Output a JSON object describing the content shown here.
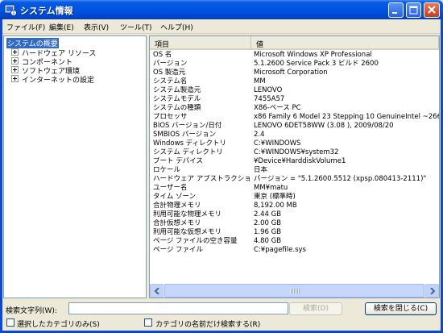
{
  "window": {
    "title": "システム情報",
    "icon": "system-info-icon",
    "accent": "#0054e3"
  },
  "menu": [
    "ファイル(F)",
    "編集(E)",
    "表示(V)",
    "ツール(T)",
    "ヘルプ(H)"
  ],
  "tree": {
    "root": "システムの概要",
    "children": [
      "ハードウェア リソース",
      "コンポーネント",
      "ソフトウェア環境",
      "インターネットの設定"
    ]
  },
  "table": {
    "headers": [
      "項目",
      "値"
    ],
    "rows": [
      [
        "OS 名",
        "Microsoft Windows XP Professional"
      ],
      [
        "バージョン",
        "5.1.2600 Service Pack 3 ビルド 2600"
      ],
      [
        "OS 製造元",
        "Microsoft Corporation"
      ],
      [
        "システム名",
        "MM"
      ],
      [
        "システム製造元",
        "LENOVO"
      ],
      [
        "システムモデル",
        "7455A57"
      ],
      [
        "システムの種類",
        "X86-ベース PC"
      ],
      [
        "プロセッサ",
        "x86 Family 6 Model 23 Stepping 10 GenuineIntel ~2660"
      ],
      [
        "BIOS バージョン/日付",
        "LENOVO 6DET58WW (3.08 ), 2009/08/20"
      ],
      [
        "SMBIOS バージョン",
        "2.4"
      ],
      [
        "Windows ディレクトリ",
        "C:¥WINDOWS"
      ],
      [
        "システム ディレクトリ",
        "C:¥WINDOWS¥system32"
      ],
      [
        "ブート デバイス",
        "¥Device¥HarddiskVolume1"
      ],
      [
        "ロケール",
        "日本"
      ],
      [
        "ハードウェア アブストラクション...",
        "バージョン = \"5.1.2600.5512 (xpsp.080413-2111)\""
      ],
      [
        "ユーザー名",
        "MM¥matu"
      ],
      [
        "タイム ゾーン",
        "東京 (標準時)"
      ],
      [
        "合計物理メモリ",
        "8,192.00 MB"
      ],
      [
        "利用可能な物理メモリ",
        "2.44 GB"
      ],
      [
        "合計仮想メモリ",
        "2.00 GB"
      ],
      [
        "利用可能な仮想メモリ",
        "1.96 GB"
      ],
      [
        "ページ ファイルの空き容量",
        "4.80 GB"
      ],
      [
        "ページ ファイル",
        "C:¥pagefile.sys"
      ]
    ]
  },
  "find": {
    "label": "検索文字列(W):",
    "value": "",
    "search_button": "検索(D)",
    "close_button": "検索を閉じる(C)",
    "selected_category_only": "選択したカテゴリのみ(S)",
    "category_names_only": "カテゴリの名前だけ検索する(R)"
  }
}
